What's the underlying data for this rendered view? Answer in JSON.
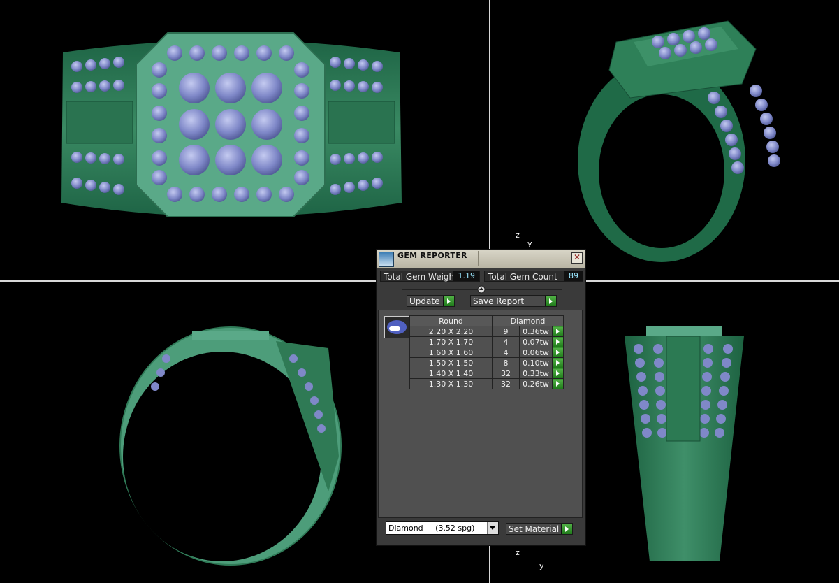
{
  "colors": {
    "metal": "#2f7a55",
    "metal_light": "#4fa17a",
    "metal_dark": "#17553a",
    "gem": "#7f88c8",
    "gem_light": "#b3bbe6",
    "panel_bg": "#3a3a3a",
    "accent_green": "#2f9a2a",
    "value_text": "#9be7ff"
  },
  "gem_reporter": {
    "title": "GEM REPORTER",
    "total_weight_label": "Total Gem Weight",
    "total_weight_value": "1.19",
    "total_count_label": "Total Gem Count",
    "total_count_value": "89",
    "update_label": "Update",
    "save_report_label": "Save Report",
    "table": {
      "col_shape": "Round",
      "col_material": "Diamond",
      "rows": [
        {
          "size": "2.20 X 2.20",
          "count": "9",
          "weight": "0.36tw"
        },
        {
          "size": "1.70 X 1.70",
          "count": "4",
          "weight": "0.07tw"
        },
        {
          "size": "1.60 X 1.60",
          "count": "4",
          "weight": "0.06tw"
        },
        {
          "size": "1.50 X 1.50",
          "count": "8",
          "weight": "0.10tw"
        },
        {
          "size": "1.40 X 1.40",
          "count": "32",
          "weight": "0.33tw"
        },
        {
          "size": "1.30 X 1.30",
          "count": "32",
          "weight": "0.26tw"
        }
      ]
    },
    "material_select": "Diamond     (3.52 spg)",
    "set_material_label": "Set Material"
  },
  "axes": {
    "z": "z",
    "y": "y"
  },
  "icons": [
    "gem-reporter-icon",
    "close-icon",
    "arrow-right-icon",
    "dropdown-arrow-icon",
    "round-gem-icon"
  ]
}
